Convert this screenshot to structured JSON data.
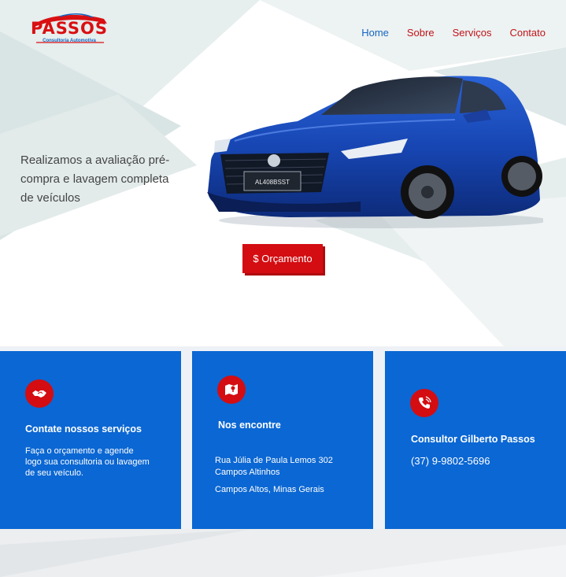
{
  "brand": {
    "name": "PASSOS",
    "subtitle": "Consultoria Automotiva"
  },
  "nav": {
    "items": [
      {
        "label": "Home",
        "active": true
      },
      {
        "label": "Sobre",
        "active": false
      },
      {
        "label": "Serviços",
        "active": false
      },
      {
        "label": "Contato",
        "active": false
      }
    ]
  },
  "hero": {
    "tagline": "Realizamos a avaliação pré-compra e lavagem completa de veículos",
    "cta_label": "$ Orçamento",
    "car_plate": "AL408BSST"
  },
  "cards": [
    {
      "icon": "handshake-icon",
      "title": "Contate nossos serviços",
      "text": "Faça o orçamento e agende logo sua consultoria ou lavagem de seu veículo."
    },
    {
      "icon": "map-icon",
      "title": "Nos encontre",
      "address_line1": "Rua Júlia de Paula Lemos 302",
      "address_line2": "Campos Altinhos",
      "city": "Campos Altos, Minas Gerais"
    },
    {
      "icon": "phone-icon",
      "title": "Consultor Gilberto Passos",
      "phone": "(37) 9-9802-5696"
    }
  ],
  "colors": {
    "brand_red": "#d30d12",
    "brand_blue": "#0b67d3",
    "nav_active": "#1565c0"
  }
}
